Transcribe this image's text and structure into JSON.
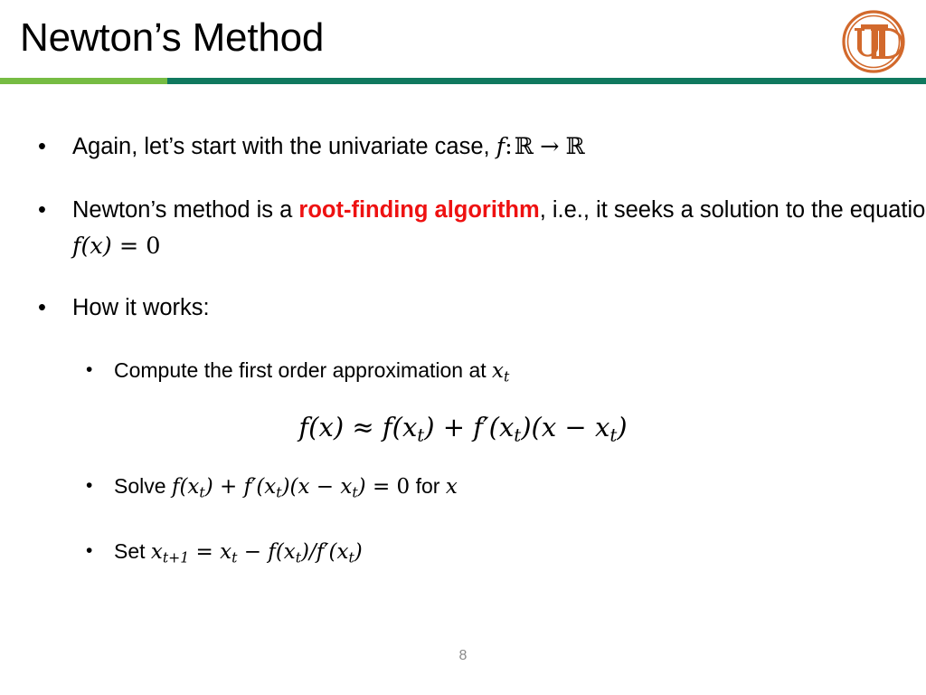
{
  "slide": {
    "title": "Newton’s Method",
    "page_number": "8",
    "accent_green": "#76BC43",
    "accent_teal": "#10795F",
    "highlight_red": "#EE1111",
    "logo_orange": "#D2692C",
    "logo_text": "UTD"
  },
  "bullets": {
    "b1_text": "Again, let’s start with the univariate case, ",
    "b1_math_f": "f",
    "b1_math_colon": ":",
    "b1_math_r1": "ℝ",
    "b1_math_arrow": "→",
    "b1_math_r2": "ℝ",
    "b2_part1": "Newton’s method is a ",
    "b2_highlight": "root-finding algorithm",
    "b2_part2": ", i.e., it seeks a solution to the equation ",
    "b2_math_f": "f",
    "b2_math_px": "(x)",
    "b2_math_eq0": " = 0",
    "b3_text": "How it works:",
    "s1_text": "Compute the first order approximation at ",
    "s1_math_x": "x",
    "s1_math_sub": "t",
    "eq_f1": "f",
    "eq_px": "(x)",
    "eq_approx": " ≈ ",
    "eq_f2": "f",
    "eq_open": "(x",
    "eq_sub1": "t",
    "eq_close": ")",
    "eq_plus": " + ",
    "eq_f3": "f",
    "eq_prime": "′",
    "eq_open2": "(x",
    "eq_sub2": "t",
    "eq_close2": ")",
    "eq_open3": "(x",
    "eq_minus": " − ",
    "eq_x4": "x",
    "eq_sub3": "t",
    "eq_close3": ")",
    "s2_label": "Solve ",
    "s2_f1": "f",
    "s2_o1": "(x",
    "s2_sub1": "t",
    "s2_c1": ")",
    "s2_plus": " + ",
    "s2_f2": "f",
    "s2_prime": "′",
    "s2_o2": "(x",
    "s2_sub2": "t",
    "s2_c2": ")",
    "s2_o3": "(x",
    "s2_minus": " − ",
    "s2_x": "x",
    "s2_sub3": "t",
    "s2_c3": ")",
    "s2_eq0": " = 0",
    "s2_for": " for ",
    "s2_xvar": "x",
    "s3_label": "Set ",
    "s3_x1": "x",
    "s3_sub1": "t+1",
    "s3_eq": " = ",
    "s3_x2": "x",
    "s3_sub2": "t",
    "s3_minus": " − ",
    "s3_f1": "f",
    "s3_o1": "(x",
    "s3_sub3": "t",
    "s3_c1": ")",
    "s3_slash": "/",
    "s3_f2": "f",
    "s3_prime": "′",
    "s3_o2": "(x",
    "s3_sub4": "t",
    "s3_c2": ")",
    "dot_glyph": "•"
  }
}
